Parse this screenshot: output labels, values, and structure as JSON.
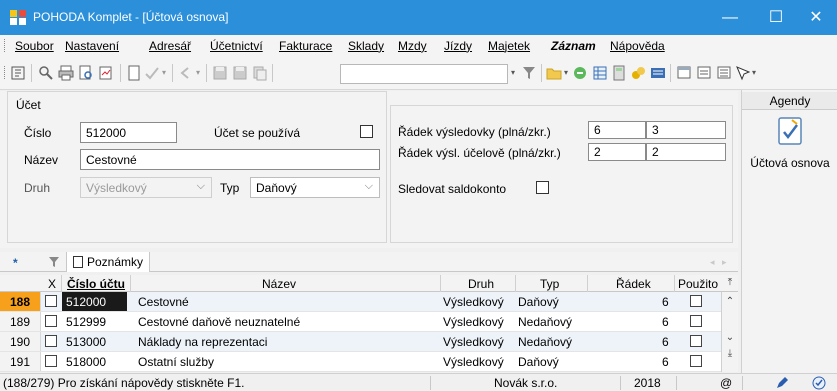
{
  "window": {
    "title": "POHODA Komplet - [Účtová osnova]",
    "minimize": "—",
    "maximize": "☐",
    "close": "✕"
  },
  "menu": [
    "Soubor",
    "Nastavení",
    "Adresář",
    "Účetnictví",
    "Fakturace",
    "Sklady",
    "Mzdy",
    "Jízdy",
    "Majetek",
    "Záznam",
    "Nápověda"
  ],
  "form": {
    "section_label": "Účet",
    "cislo_label": "Číslo",
    "cislo_value": "512000",
    "pouziva_label": "Účet se používá",
    "nazev_label": "Název",
    "nazev_value": "Cestovné",
    "druh_label": "Druh",
    "druh_value": "Výsledkový",
    "typ_label": "Typ",
    "typ_value": "Daňový",
    "radek_vysl_label": "Řádek výsledovky (plná/zkr.)",
    "radek_vysl_full": "6",
    "radek_vysl_short": "3",
    "radek_ucel_label": "Řádek výsl. účelově (plná/zkr.)",
    "radek_ucel_full": "2",
    "radek_ucel_short": "2",
    "saldokonto_label": "Sledovat saldokonto"
  },
  "agendy": {
    "header": "Agendy",
    "item": "Účtová osnova"
  },
  "tabs": {
    "star": "*",
    "poznamky": "Poznámky"
  },
  "grid": {
    "headers": {
      "x": "X",
      "cislo": "Číslo účtu",
      "nazev": "Název",
      "druh": "Druh",
      "typ": "Typ",
      "radek": "Řádek",
      "pouzito": "Použito"
    },
    "rows": [
      {
        "num": "188",
        "cislo": "512000",
        "nazev": "Cestovné",
        "druh": "Výsledkový",
        "typ": "Daňový",
        "radek": "6"
      },
      {
        "num": "189",
        "cislo": "512999",
        "nazev": "Cestovné daňově neuznatelné",
        "druh": "Výsledkový",
        "typ": "Nedaňový",
        "radek": "6"
      },
      {
        "num": "190",
        "cislo": "513000",
        "nazev": "Náklady na reprezentaci",
        "druh": "Výsledkový",
        "typ": "Nedaňový",
        "radek": "6"
      },
      {
        "num": "191",
        "cislo": "518000",
        "nazev": "Ostatní služby",
        "druh": "Výsledkový",
        "typ": "Daňový",
        "radek": "6"
      }
    ]
  },
  "status": {
    "help": "(188/279) Pro získání nápovědy stiskněte F1.",
    "company": "Novák s.r.o.",
    "year": "2018",
    "at": "@"
  },
  "colors": {
    "titlebar": "#2b8fd9",
    "active_row": "#f7a01c"
  }
}
